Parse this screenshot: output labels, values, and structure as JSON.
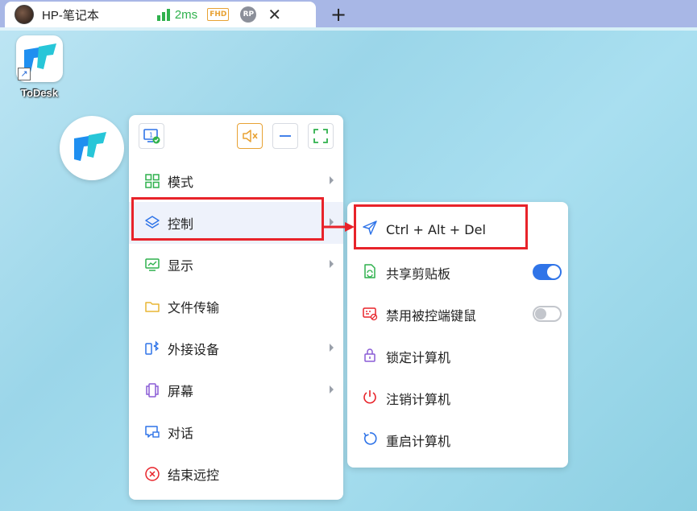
{
  "tab": {
    "title": "HP-笔记本",
    "latency": "2ms",
    "quality_badge": "FHD",
    "user_badge": "RP",
    "close_symbol": "✕",
    "new_tab_symbol": "+"
  },
  "desktop": {
    "icon_label": "ToDesk"
  },
  "menu": {
    "toolbar_icons": [
      "monitor-check-icon",
      "mute-icon",
      "minimize-icon",
      "fullscreen-icon"
    ],
    "items": [
      {
        "label": "模式",
        "icon": "grid-icon",
        "has_submenu": true
      },
      {
        "label": "控制",
        "icon": "layers-icon",
        "has_submenu": true,
        "highlighted": true
      },
      {
        "label": "显示",
        "icon": "display-icon",
        "has_submenu": true
      },
      {
        "label": "文件传输",
        "icon": "folder-icon",
        "has_submenu": false
      },
      {
        "label": "外接设备",
        "icon": "bluetooth-device-icon",
        "has_submenu": true
      },
      {
        "label": "屏幕",
        "icon": "screens-icon",
        "has_submenu": true
      },
      {
        "label": "对话",
        "icon": "chat-icon",
        "has_submenu": false
      },
      {
        "label": "结束远控",
        "icon": "close-circle-icon",
        "has_submenu": false
      }
    ]
  },
  "submenu": {
    "items": [
      {
        "label": "Ctrl + Alt + Del",
        "icon": "send-icon",
        "highlighted": true
      },
      {
        "label": "共享剪贴板",
        "icon": "clipboard-icon",
        "toggle": true,
        "toggle_on": true
      },
      {
        "label": "禁用被控端键鼠",
        "icon": "keyboard-disable-icon",
        "toggle": true,
        "toggle_on": false
      },
      {
        "label": "锁定计算机",
        "icon": "lock-icon"
      },
      {
        "label": "注销计算机",
        "icon": "power-icon"
      },
      {
        "label": "重启计算机",
        "icon": "restart-icon"
      }
    ]
  },
  "colors": {
    "accent": "#2f74e8",
    "highlight_red": "#e8232a",
    "green": "#2fb14d",
    "orange": "#e8a234"
  }
}
